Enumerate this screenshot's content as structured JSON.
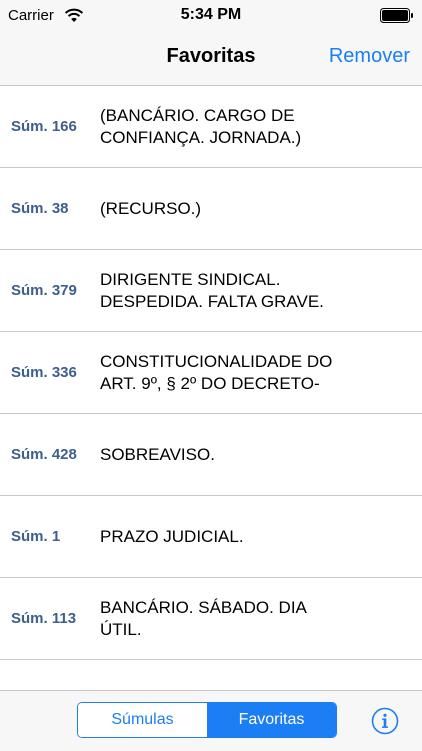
{
  "status_bar": {
    "carrier": "Carrier",
    "time": "5:34 PM"
  },
  "nav": {
    "title": "Favoritas",
    "action": "Remover"
  },
  "items": [
    {
      "num": "Súm. 166",
      "line1": "(BANCÁRIO. CARGO DE",
      "line2": "CONFIANÇA. JORNADA.)"
    },
    {
      "num": "Súm. 38",
      "line1": "(RECURSO.)",
      "line2": ""
    },
    {
      "num": "Súm. 379",
      "line1": "DIRIGENTE SINDICAL.",
      "line2": "DESPEDIDA. FALTA GRAVE."
    },
    {
      "num": "Súm. 336",
      "line1": "CONSTITUCIONALIDADE DO",
      "line2": "ART. 9º, § 2º DO DECRETO-"
    },
    {
      "num": "Súm. 428",
      "line1": "SOBREAVISO.",
      "line2": ""
    },
    {
      "num": "Súm. 1",
      "line1": "PRAZO JUDICIAL.",
      "line2": ""
    },
    {
      "num": "Súm. 113",
      "line1": "BANCÁRIO. SÁBADO. DIA",
      "line2": "ÚTIL."
    }
  ],
  "bottom": {
    "segments": [
      "Súmulas",
      "Favoritas"
    ],
    "selected": "Favoritas"
  },
  "colors": {
    "accent": "#1c7ef5",
    "number": "#3d5f8c",
    "separator": "#c8c7cc",
    "bar_bg": "#f7f7f7"
  },
  "icons": [
    "wifi-icon",
    "battery-icon",
    "info-icon"
  ]
}
